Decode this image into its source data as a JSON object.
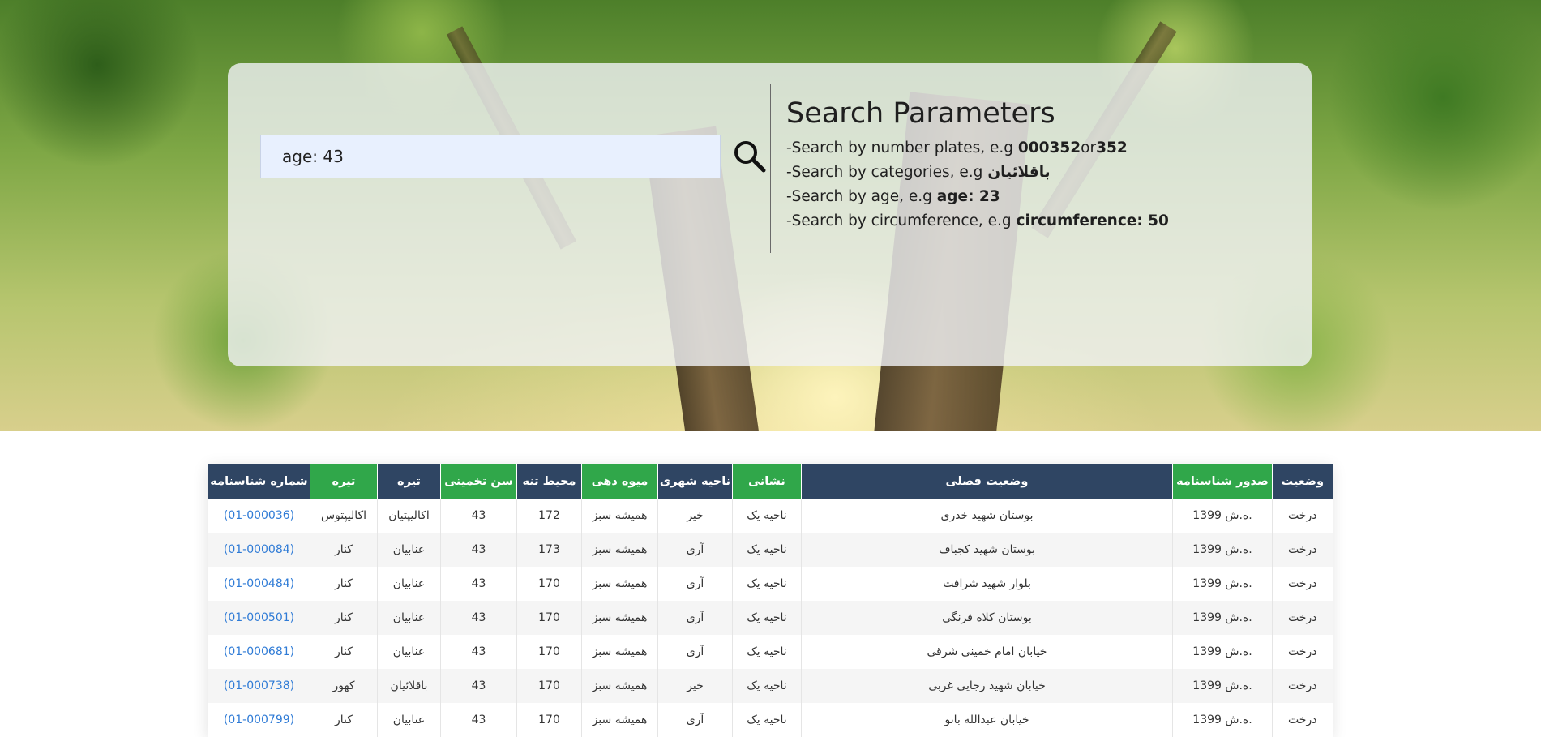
{
  "search": {
    "value": "age: 43",
    "button_icon": "search-icon"
  },
  "params": {
    "title": "Search Parameters",
    "lines": [
      {
        "prefix": "-Search by number plates, e.g ",
        "bold1": "000352",
        "mid": "or",
        "bold2": "352"
      },
      {
        "prefix": "-Search by categories, e.g ",
        "bold1": "باقلائیان"
      },
      {
        "prefix": "-Search by age, e.g ",
        "bold1": "age: 23"
      },
      {
        "prefix": "-Search by circumference, e.g ",
        "bold1": "circumference: 50"
      }
    ]
  },
  "table": {
    "headers": [
      {
        "label": "وضعیت",
        "color": "navy"
      },
      {
        "label": "صدور شناسنامه",
        "color": "green"
      },
      {
        "label": "وضعیت فصلی",
        "color": "navy"
      },
      {
        "label": "نشانی",
        "color": "green"
      },
      {
        "label": "ناحیه شهری",
        "color": "navy"
      },
      {
        "label": "میوه دهی",
        "color": "green"
      },
      {
        "label": "محیط تنه",
        "color": "navy"
      },
      {
        "label": "سن تخمینی",
        "color": "green"
      },
      {
        "label": "تیره",
        "color": "navy"
      },
      {
        "label": "تیره",
        "color": "green"
      },
      {
        "label": "شماره شناسنامه",
        "color": "navy"
      }
    ],
    "rows": [
      [
        "درخت",
        ".ه.ش 1399",
        "بوستان شهید خدری",
        "ناحیه یک",
        "خیر",
        "همیشه سبز",
        "172",
        "43",
        "اکالیپتیان",
        "اکالیپتوس",
        "(01-000036)"
      ],
      [
        "درخت",
        ".ه.ش 1399",
        "بوستان شهید کجباف",
        "ناحیه یک",
        "آری",
        "همیشه سبز",
        "173",
        "43",
        "عنابیان",
        "کنار",
        "(01-000084)"
      ],
      [
        "درخت",
        ".ه.ش 1399",
        "بلوار شهید شرافت",
        "ناحیه یک",
        "آری",
        "همیشه سبز",
        "170",
        "43",
        "عنابیان",
        "کنار",
        "(01-000484)"
      ],
      [
        "درخت",
        ".ه.ش 1399",
        "بوستان کلاه فرنگی",
        "ناحیه یک",
        "آری",
        "همیشه سبز",
        "170",
        "43",
        "عنابیان",
        "کنار",
        "(01-000501)"
      ],
      [
        "درخت",
        ".ه.ش 1399",
        "خیابان امام خمینی شرقی",
        "ناحیه یک",
        "آری",
        "همیشه سبز",
        "170",
        "43",
        "عنابیان",
        "کنار",
        "(01-000681)"
      ],
      [
        "درخت",
        ".ه.ش 1399",
        "خیابان شهید رجایی غربی",
        "ناحیه یک",
        "خیر",
        "همیشه سبز",
        "170",
        "43",
        "باقلائیان",
        "کهور",
        "(01-000738)"
      ],
      [
        "درخت",
        ".ه.ش 1399",
        "خیابان عبدالله بانو",
        "ناحیه یک",
        "آری",
        "همیشه سبز",
        "170",
        "43",
        "عنابیان",
        "کنار",
        "(01-000799)"
      ]
    ]
  },
  "colors": {
    "navy": "#2f4563",
    "green": "#30a74a",
    "link": "#2f7bd6"
  }
}
